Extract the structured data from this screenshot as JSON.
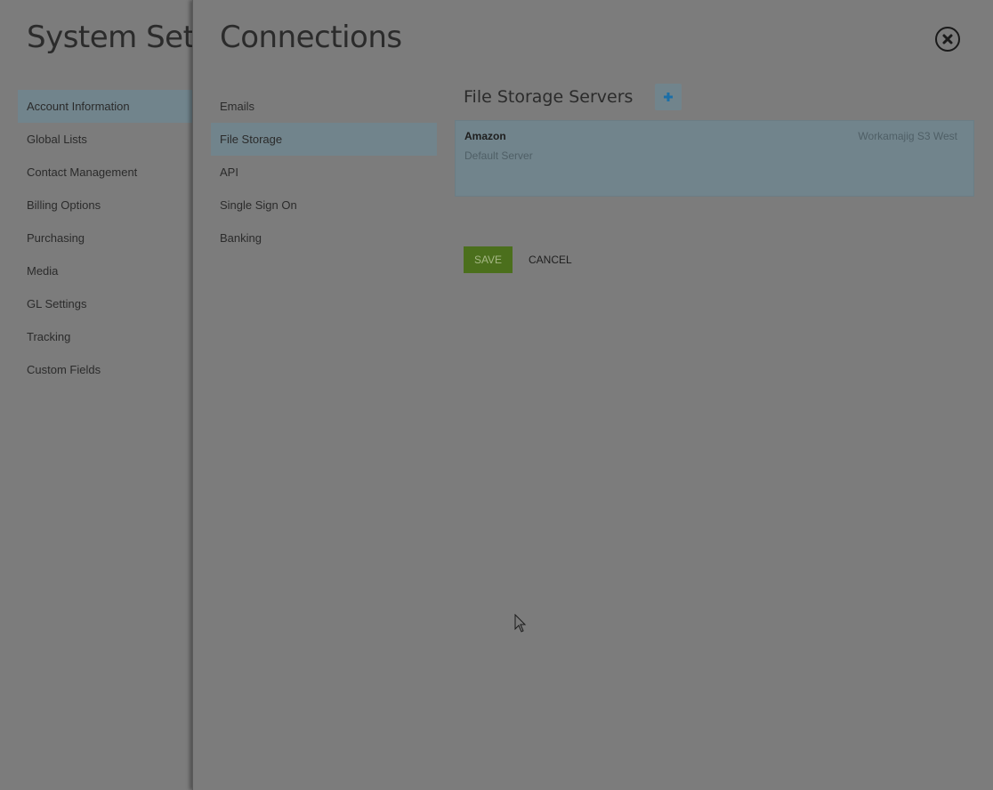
{
  "background_page": {
    "title": "System Setu",
    "nav_items": [
      {
        "label": "Account Information",
        "active": true
      },
      {
        "label": "Global Lists",
        "active": false
      },
      {
        "label": "Contact Management",
        "active": false
      },
      {
        "label": "Billing Options",
        "active": false
      },
      {
        "label": "Purchasing",
        "active": false
      },
      {
        "label": "Media",
        "active": false
      },
      {
        "label": "GL Settings",
        "active": false
      },
      {
        "label": "Tracking",
        "active": false
      },
      {
        "label": "Custom Fields",
        "active": false
      }
    ]
  },
  "panel": {
    "title": "Connections",
    "close_icon": "close-circle-icon",
    "sub_nav": [
      {
        "label": "Emails",
        "active": false
      },
      {
        "label": "File Storage",
        "active": true
      },
      {
        "label": "API",
        "active": false
      },
      {
        "label": "Single Sign On",
        "active": false
      },
      {
        "label": "Banking",
        "active": false
      }
    ],
    "section": {
      "title": "File Storage Servers",
      "add_icon": "plus-icon"
    },
    "servers": [
      {
        "name": "Amazon",
        "region": "Workamajig S3 West",
        "note": "Default Server"
      }
    ],
    "actions": {
      "save_label": "SAVE",
      "cancel_label": "CANCEL"
    }
  },
  "colors": {
    "overlay_bg": "#7c7c7c",
    "active_row": "#71848c",
    "save_button": "#4b6f1c",
    "add_icon": "#1b6fa8"
  }
}
